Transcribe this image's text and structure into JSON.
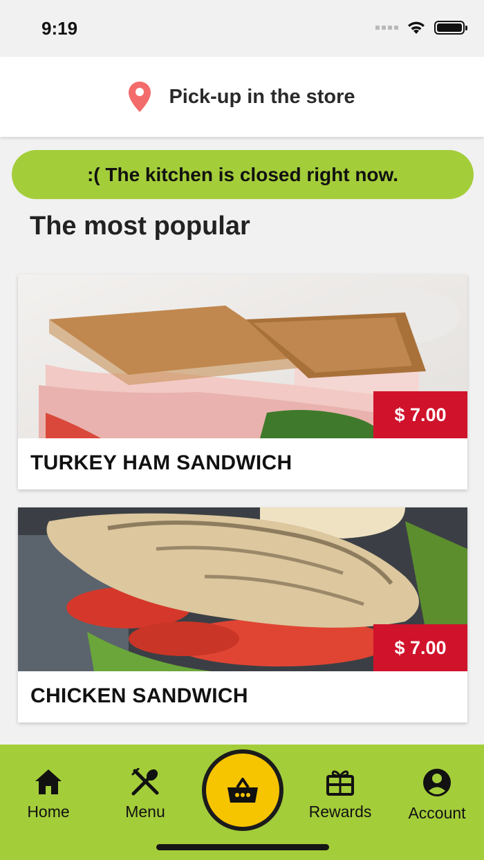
{
  "status_bar": {
    "time": "9:19"
  },
  "pickup": {
    "label": "Pick-up in the store",
    "icon": "location-pin-icon",
    "icon_color": "#f36b6b"
  },
  "banner": {
    "text": ":( The kitchen is closed right now.",
    "color": "#a4cd3a"
  },
  "section": {
    "title": "The most popular"
  },
  "products": [
    {
      "name": "TURKEY HAM SANDWICH",
      "price": "$ 7.00"
    },
    {
      "name": "CHICKEN SANDWICH",
      "price": "$ 7.00"
    }
  ],
  "price_color": "#d0122b",
  "nav": {
    "background": "#a4cd3a",
    "items": [
      {
        "label": "Home",
        "icon": "home-icon"
      },
      {
        "label": "Menu",
        "icon": "fork-spoon-icon"
      },
      {
        "label": "Rewards",
        "icon": "gift-icon"
      },
      {
        "label": "Account",
        "icon": "account-circle-icon"
      }
    ],
    "cart": {
      "icon": "basket-icon",
      "color": "#f7c400"
    }
  }
}
